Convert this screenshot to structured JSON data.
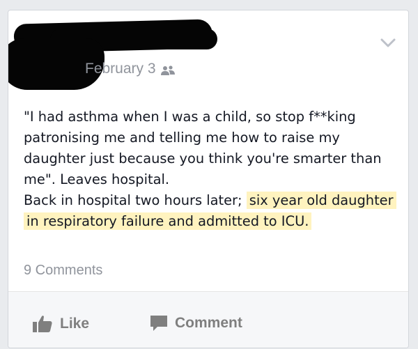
{
  "post": {
    "author_name": "",
    "date": "February 3",
    "audience_icon": "friends-icon",
    "menu_icon": "chevron-down-icon",
    "text_line_1": "\"I had asthma when I was a child, so stop f**king patronising me and telling me how to raise my daughter just because you think you're smarter than me\". Leaves hospital.",
    "text_line_2_plain": "Back in hospital two hours later; ",
    "text_line_2_highlight": "six year old daughter in respiratory failure and admitted to ICU.",
    "highlight_color": "#fff3bf"
  },
  "comments": {
    "count_label": "9 Comments"
  },
  "actions": {
    "like_label": "Like",
    "like_icon": "thumbs-up-icon",
    "comment_label": "Comment",
    "comment_icon": "speech-bubble-icon"
  }
}
